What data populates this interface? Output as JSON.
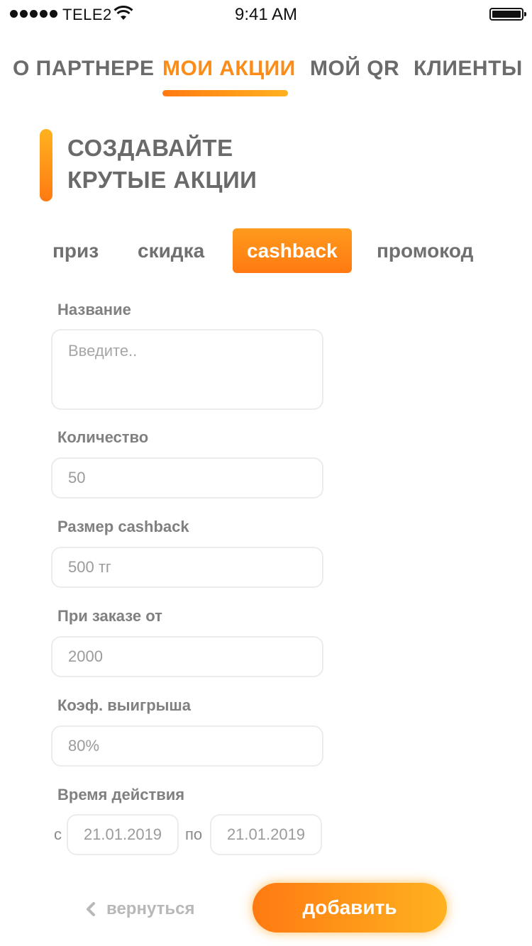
{
  "status_bar": {
    "carrier": "TELE2",
    "time": "9:41 AM"
  },
  "top_nav": {
    "items": [
      {
        "label": "О ПАРТНЕРЕ",
        "active": false
      },
      {
        "label": "МОИ АКЦИИ",
        "active": true
      },
      {
        "label": "МОЙ QR",
        "active": false
      },
      {
        "label": "КЛИЕНТЫ",
        "active": false
      }
    ]
  },
  "heading": {
    "line1": "СОЗДАВАЙТЕ",
    "line2": "КРУТЫЕ АКЦИИ"
  },
  "promo_types": {
    "tabs": [
      {
        "label": "приз",
        "active": false
      },
      {
        "label": "скидка",
        "active": false
      },
      {
        "label": "cashback",
        "active": true
      },
      {
        "label": "промокод",
        "active": false
      }
    ]
  },
  "form": {
    "name": {
      "label": "Название",
      "placeholder": "Введите..",
      "value": ""
    },
    "quantity": {
      "label": "Количество",
      "value": "50"
    },
    "cashback_size": {
      "label": "Размер cashback",
      "value": "500 тг"
    },
    "min_order": {
      "label": "При заказе от",
      "value": "2000"
    },
    "win_coef": {
      "label": "Коэф. выигрыша",
      "value": "80%"
    },
    "period": {
      "label": "Время действия",
      "from_label": "с",
      "from_value": "21.01.2019",
      "to_label": "по",
      "to_value": "21.01.2019"
    }
  },
  "actions": {
    "back_label": "вернуться",
    "add_label": "добавить"
  },
  "colors": {
    "accent_start": "#ff7a12",
    "accent_end": "#ffb21f",
    "text_gray": "#6e6e6e"
  }
}
